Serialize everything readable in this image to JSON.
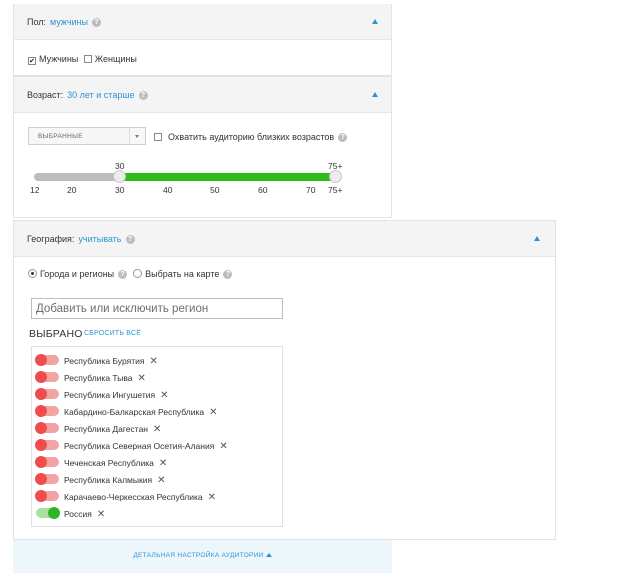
{
  "gender": {
    "label": "Пол:",
    "value": "мужчины",
    "help": "?",
    "options": [
      {
        "label": "Мужчины",
        "checked": true
      },
      {
        "label": "Женщины",
        "checked": false
      }
    ]
  },
  "age": {
    "label": "Возраст:",
    "value": "30 лет и старше",
    "help": "?",
    "select_value": "ВЫБРАННЫЕ",
    "close_ages_label": "Охватить аудиторию близких возрастов",
    "close_ages_checked": false,
    "slider": {
      "min_label": "30",
      "max_label": "75+",
      "selected_min": 30,
      "selected_max": "75+",
      "ticks": [
        "12",
        "20",
        "30",
        "40",
        "50",
        "60",
        "70",
        "75+"
      ]
    }
  },
  "geo": {
    "label": "География:",
    "value": "учитывать",
    "help": "?",
    "mode_regions": "Города и регионы",
    "mode_map": "Выбрать на карте",
    "region_placeholder": "Добавить или исключить регион",
    "selected_title": "ВЫБРАНО",
    "reset_label": "СБРОСИТЬ ВСЁ",
    "remove_glyph": "✕",
    "regions": [
      {
        "name": "Республика Бурятия",
        "state": "excluded"
      },
      {
        "name": "Республика Тыва",
        "state": "excluded"
      },
      {
        "name": "Республика Ингушетия",
        "state": "excluded"
      },
      {
        "name": "Кабардино-Балкарская Республика",
        "state": "excluded"
      },
      {
        "name": "Республика Дагестан",
        "state": "excluded"
      },
      {
        "name": "Республика Северная Осетия-Алания",
        "state": "excluded"
      },
      {
        "name": "Чеченская Республика",
        "state": "excluded"
      },
      {
        "name": "Республика Калмыкия",
        "state": "excluded"
      },
      {
        "name": "Карачаево-Черкесская Республика",
        "state": "excluded"
      },
      {
        "name": "Россия",
        "state": "included"
      }
    ]
  },
  "footer": {
    "link": "ДЕТАЛЬНАЯ НАСТРОЙКА АУДИТОРИИ"
  },
  "colors": {
    "accent": "#2a95d5",
    "slider_active": "#2dbd18",
    "excluded": "#ef4d4d",
    "included": "#2fb52a"
  },
  "icons": {
    "collapse": "caret-up-icon",
    "help": "question-circle-icon",
    "remove": "close-icon"
  }
}
